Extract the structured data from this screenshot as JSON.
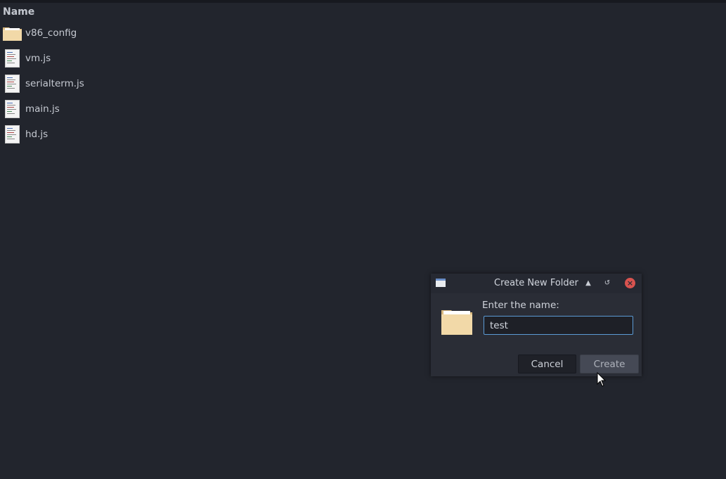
{
  "file_list": {
    "column_header": "Name",
    "items": [
      {
        "name": "v86_config",
        "icon": "folder-icon"
      },
      {
        "name": "vm.js",
        "icon": "js-file-icon"
      },
      {
        "name": "serialterm.js",
        "icon": "js-file-icon"
      },
      {
        "name": "main.js",
        "icon": "js-file-icon"
      },
      {
        "name": "hd.js",
        "icon": "js-file-icon"
      }
    ]
  },
  "dialog": {
    "title": "Create New Folder",
    "prompt": "Enter the name:",
    "input_value": "test",
    "cancel_label": "Cancel",
    "create_label": "Create",
    "titlebar_icons": [
      "window-icon",
      "shade-icon",
      "restore-icon",
      "close-icon"
    ]
  },
  "colors": {
    "background": "#22252d",
    "dialog": "#2a2d36",
    "accent": "#5b9bd5",
    "close": "#d9534f",
    "folder": "#f2d9a8"
  }
}
